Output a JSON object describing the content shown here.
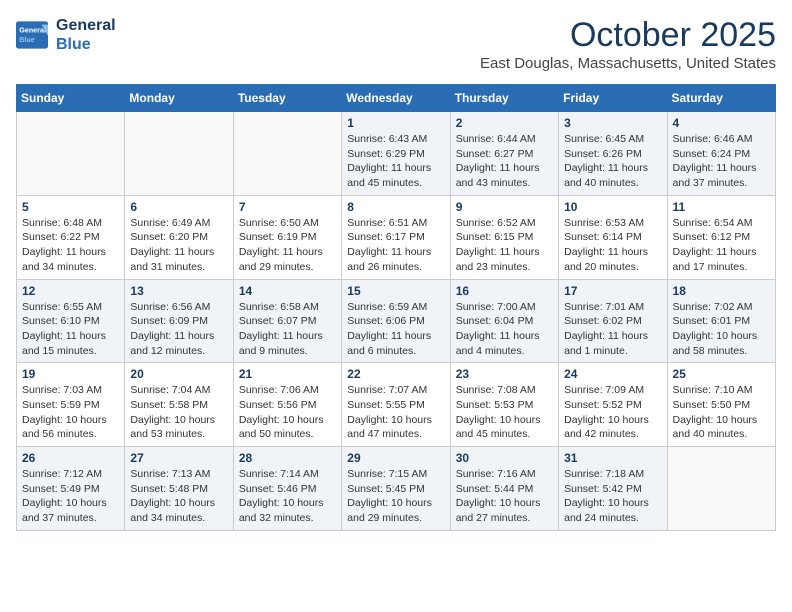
{
  "header": {
    "logo_line1": "General",
    "logo_line2": "Blue",
    "month": "October 2025",
    "location": "East Douglas, Massachusetts, United States"
  },
  "weekdays": [
    "Sunday",
    "Monday",
    "Tuesday",
    "Wednesday",
    "Thursday",
    "Friday",
    "Saturday"
  ],
  "weeks": [
    [
      {
        "day": "",
        "info": ""
      },
      {
        "day": "",
        "info": ""
      },
      {
        "day": "",
        "info": ""
      },
      {
        "day": "1",
        "info": "Sunrise: 6:43 AM\nSunset: 6:29 PM\nDaylight: 11 hours\nand 45 minutes."
      },
      {
        "day": "2",
        "info": "Sunrise: 6:44 AM\nSunset: 6:27 PM\nDaylight: 11 hours\nand 43 minutes."
      },
      {
        "day": "3",
        "info": "Sunrise: 6:45 AM\nSunset: 6:26 PM\nDaylight: 11 hours\nand 40 minutes."
      },
      {
        "day": "4",
        "info": "Sunrise: 6:46 AM\nSunset: 6:24 PM\nDaylight: 11 hours\nand 37 minutes."
      }
    ],
    [
      {
        "day": "5",
        "info": "Sunrise: 6:48 AM\nSunset: 6:22 PM\nDaylight: 11 hours\nand 34 minutes."
      },
      {
        "day": "6",
        "info": "Sunrise: 6:49 AM\nSunset: 6:20 PM\nDaylight: 11 hours\nand 31 minutes."
      },
      {
        "day": "7",
        "info": "Sunrise: 6:50 AM\nSunset: 6:19 PM\nDaylight: 11 hours\nand 29 minutes."
      },
      {
        "day": "8",
        "info": "Sunrise: 6:51 AM\nSunset: 6:17 PM\nDaylight: 11 hours\nand 26 minutes."
      },
      {
        "day": "9",
        "info": "Sunrise: 6:52 AM\nSunset: 6:15 PM\nDaylight: 11 hours\nand 23 minutes."
      },
      {
        "day": "10",
        "info": "Sunrise: 6:53 AM\nSunset: 6:14 PM\nDaylight: 11 hours\nand 20 minutes."
      },
      {
        "day": "11",
        "info": "Sunrise: 6:54 AM\nSunset: 6:12 PM\nDaylight: 11 hours\nand 17 minutes."
      }
    ],
    [
      {
        "day": "12",
        "info": "Sunrise: 6:55 AM\nSunset: 6:10 PM\nDaylight: 11 hours\nand 15 minutes."
      },
      {
        "day": "13",
        "info": "Sunrise: 6:56 AM\nSunset: 6:09 PM\nDaylight: 11 hours\nand 12 minutes."
      },
      {
        "day": "14",
        "info": "Sunrise: 6:58 AM\nSunset: 6:07 PM\nDaylight: 11 hours\nand 9 minutes."
      },
      {
        "day": "15",
        "info": "Sunrise: 6:59 AM\nSunset: 6:06 PM\nDaylight: 11 hours\nand 6 minutes."
      },
      {
        "day": "16",
        "info": "Sunrise: 7:00 AM\nSunset: 6:04 PM\nDaylight: 11 hours\nand 4 minutes."
      },
      {
        "day": "17",
        "info": "Sunrise: 7:01 AM\nSunset: 6:02 PM\nDaylight: 11 hours\nand 1 minute."
      },
      {
        "day": "18",
        "info": "Sunrise: 7:02 AM\nSunset: 6:01 PM\nDaylight: 10 hours\nand 58 minutes."
      }
    ],
    [
      {
        "day": "19",
        "info": "Sunrise: 7:03 AM\nSunset: 5:59 PM\nDaylight: 10 hours\nand 56 minutes."
      },
      {
        "day": "20",
        "info": "Sunrise: 7:04 AM\nSunset: 5:58 PM\nDaylight: 10 hours\nand 53 minutes."
      },
      {
        "day": "21",
        "info": "Sunrise: 7:06 AM\nSunset: 5:56 PM\nDaylight: 10 hours\nand 50 minutes."
      },
      {
        "day": "22",
        "info": "Sunrise: 7:07 AM\nSunset: 5:55 PM\nDaylight: 10 hours\nand 47 minutes."
      },
      {
        "day": "23",
        "info": "Sunrise: 7:08 AM\nSunset: 5:53 PM\nDaylight: 10 hours\nand 45 minutes."
      },
      {
        "day": "24",
        "info": "Sunrise: 7:09 AM\nSunset: 5:52 PM\nDaylight: 10 hours\nand 42 minutes."
      },
      {
        "day": "25",
        "info": "Sunrise: 7:10 AM\nSunset: 5:50 PM\nDaylight: 10 hours\nand 40 minutes."
      }
    ],
    [
      {
        "day": "26",
        "info": "Sunrise: 7:12 AM\nSunset: 5:49 PM\nDaylight: 10 hours\nand 37 minutes."
      },
      {
        "day": "27",
        "info": "Sunrise: 7:13 AM\nSunset: 5:48 PM\nDaylight: 10 hours\nand 34 minutes."
      },
      {
        "day": "28",
        "info": "Sunrise: 7:14 AM\nSunset: 5:46 PM\nDaylight: 10 hours\nand 32 minutes."
      },
      {
        "day": "29",
        "info": "Sunrise: 7:15 AM\nSunset: 5:45 PM\nDaylight: 10 hours\nand 29 minutes."
      },
      {
        "day": "30",
        "info": "Sunrise: 7:16 AM\nSunset: 5:44 PM\nDaylight: 10 hours\nand 27 minutes."
      },
      {
        "day": "31",
        "info": "Sunrise: 7:18 AM\nSunset: 5:42 PM\nDaylight: 10 hours\nand 24 minutes."
      },
      {
        "day": "",
        "info": ""
      }
    ]
  ]
}
